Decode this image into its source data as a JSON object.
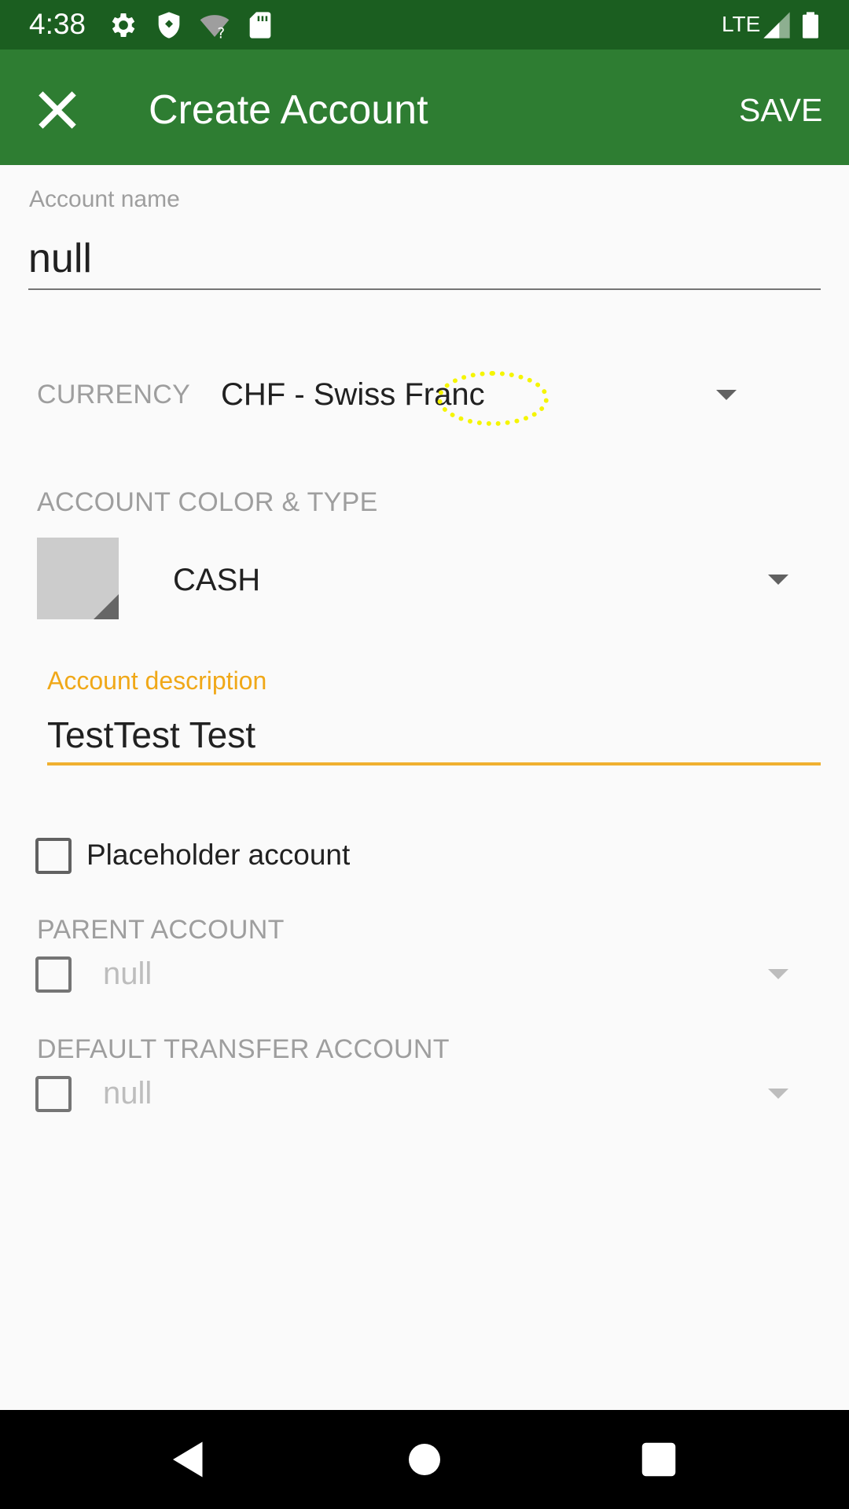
{
  "status_bar": {
    "time": "4:38",
    "icons": [
      "gear-icon",
      "shield-icon",
      "wifi-unknown-icon",
      "sd-card-icon"
    ],
    "network": "LTE",
    "right_icons": [
      "signal-icon",
      "battery-icon"
    ]
  },
  "app_bar": {
    "title": "Create Account",
    "close_icon": "close-icon",
    "save_label": "SAVE",
    "color": "#2e7d32"
  },
  "form": {
    "account_name": {
      "label": "Account name",
      "value": "null"
    },
    "currency": {
      "label": "CURRENCY",
      "value": "CHF - Swiss Franc"
    },
    "color_type": {
      "label": "ACCOUNT COLOR & TYPE",
      "swatch_color": "#cccccc",
      "type_value": "CASH"
    },
    "description": {
      "label": "Account description",
      "value": "TestTest Test",
      "accent_color": "#f0b030"
    },
    "placeholder": {
      "label": "Placeholder account",
      "checked": false
    },
    "parent_account": {
      "label": "PARENT ACCOUNT",
      "value": "null",
      "checked": false
    },
    "default_transfer": {
      "label": "DEFAULT TRANSFER ACCOUNT",
      "value": "null",
      "checked": false
    }
  },
  "nav_bar": {
    "icons": [
      "back-icon",
      "home-icon",
      "recents-icon"
    ]
  }
}
